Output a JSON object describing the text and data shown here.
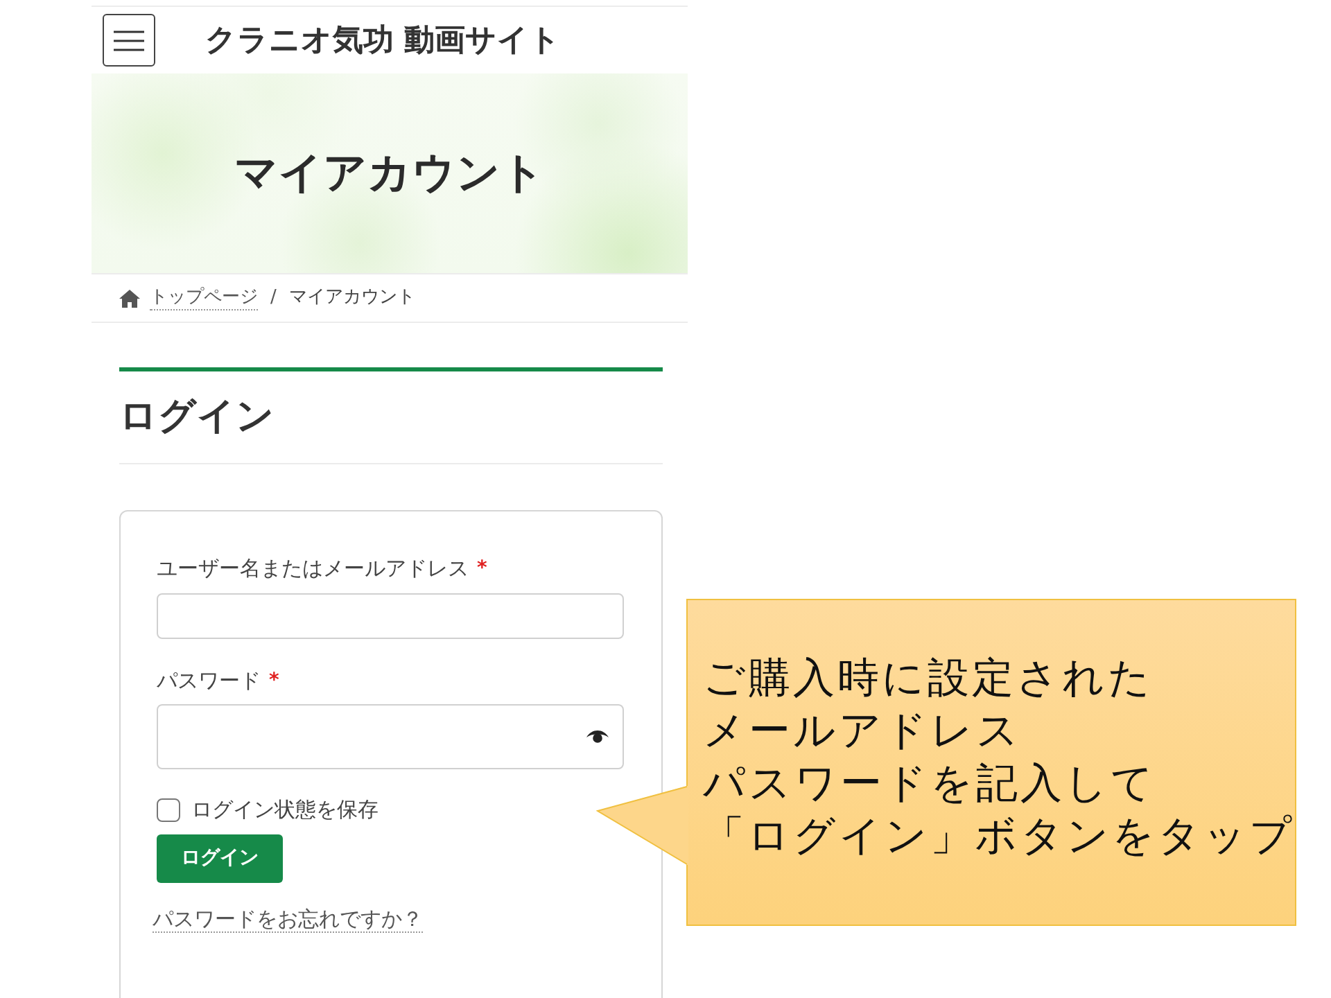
{
  "header": {
    "title": "クラニオ気功 動画サイト"
  },
  "banner": {
    "title": "マイアカウント"
  },
  "breadcrumb": {
    "separator": "/",
    "items": [
      {
        "label": "トップページ",
        "kind": "link"
      },
      {
        "label": "マイアカウント",
        "kind": "current"
      }
    ]
  },
  "section": {
    "title": "ログイン"
  },
  "login_form": {
    "fields": [
      {
        "kind": "text",
        "label": "ユーザー名またはメールアドレス",
        "required_mark": "*"
      },
      {
        "kind": "password",
        "label": "パスワード",
        "required_mark": "*"
      }
    ],
    "remember": {
      "label": "ログイン状態を保存",
      "checked": false
    },
    "submit": "ログイン",
    "forgot_link": "パスワードをお忘れですか？"
  },
  "callout": {
    "lines": [
      "ご購入時に設定された",
      "メールアドレス",
      "パスワードを記入して",
      "「ログイン」ボタンをタップ"
    ]
  }
}
